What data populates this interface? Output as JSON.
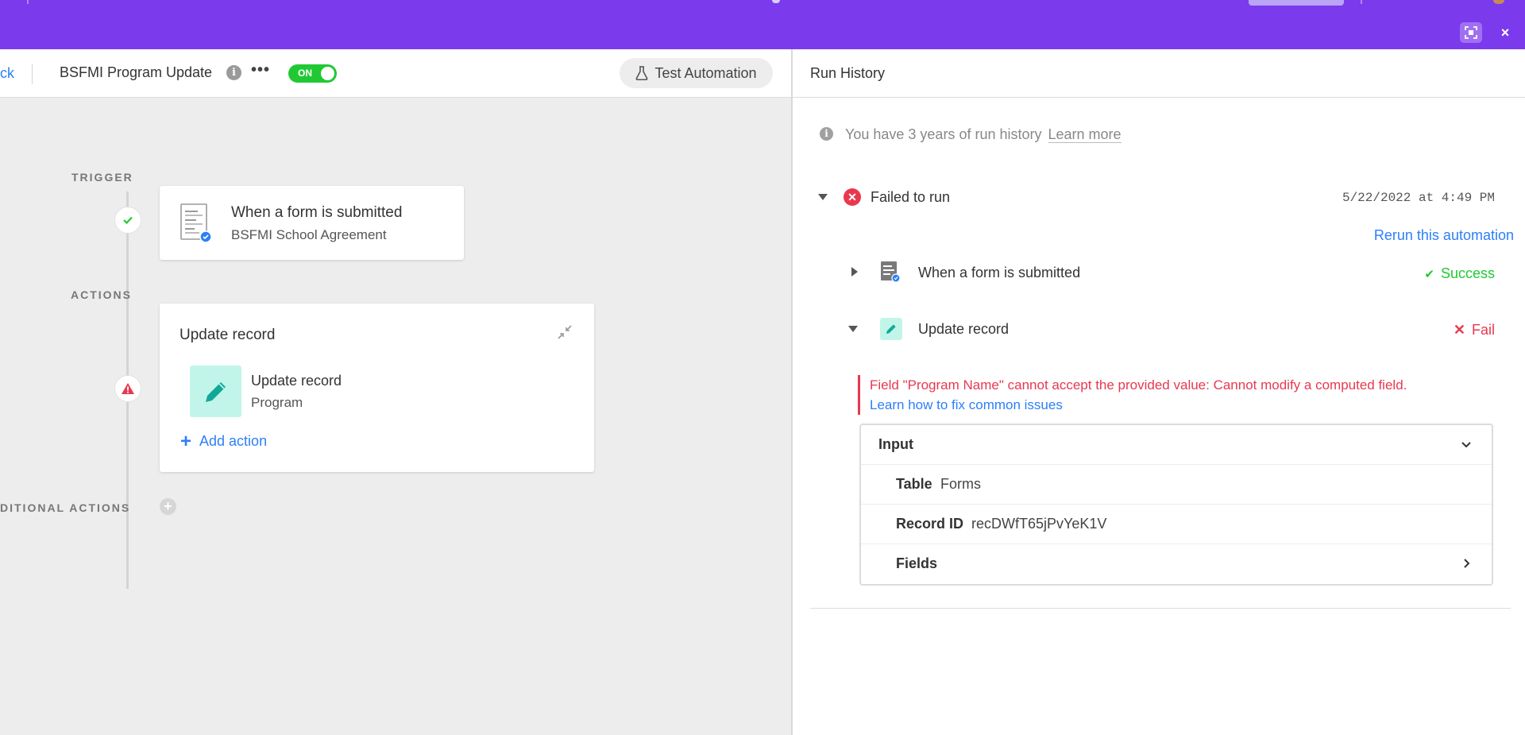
{
  "app": {
    "accent": "#7c3aed",
    "close_icon": "×"
  },
  "header": {
    "back_label": "ck",
    "automation_title": "BSFMI Program Update",
    "more_icon": "•••",
    "toggle_label": "ON",
    "test_button_label": "Test Automation"
  },
  "canvas": {
    "trigger_label": "TRIGGER",
    "actions_label": "ACTIONS",
    "conditional_label": "DITIONAL ACTIONS",
    "trigger_card": {
      "title": "When a form is submitted",
      "subtitle": "BSFMI School Agreement"
    },
    "action_card": {
      "title": "Update record",
      "item_title": "Update record",
      "item_subtitle": "Program",
      "add_action_label": "Add action"
    }
  },
  "run_history": {
    "title": "Run History",
    "history_notice": "You have 3 years of run history",
    "learn_more": "Learn more",
    "run": {
      "status": "Failed to run",
      "date": "5/22/2022 at 4:49 PM",
      "rerun_label": "Rerun this automation",
      "steps": [
        {
          "title": "When a form is submitted",
          "status": "Success",
          "status_icon": "✔"
        },
        {
          "title": "Update record",
          "status": "Fail",
          "status_icon": "✕"
        }
      ],
      "error_message": "Field \"Program Name\" cannot accept the provided value: Cannot modify a computed field.",
      "error_link": "Learn how to fix common issues",
      "input": {
        "header": "Input",
        "table_key": "Table",
        "table_value": "Forms",
        "record_key": "Record ID",
        "record_value": "recDWfT65jPvYeK1V",
        "fields_key": "Fields"
      }
    }
  },
  "colors": {
    "success": "#20c933",
    "fail": "#e8384f",
    "link": "#2d7ff9"
  }
}
